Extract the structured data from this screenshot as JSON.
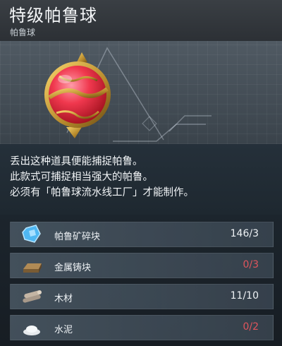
{
  "item": {
    "title": "特级帕鲁球",
    "category": "帕鲁球"
  },
  "description": [
    "丢出这种道具便能捕捉帕鲁。",
    "此款式可捕捉相当强大的帕鲁。",
    "必须有「帕鲁球流水线工厂」才能制作。"
  ],
  "materials": [
    {
      "icon": "ore-shard-icon",
      "name": "帕鲁矿碎块",
      "count": "146/3",
      "sufficient": true
    },
    {
      "icon": "ingot-icon",
      "name": "金属铸块",
      "count": "0/3",
      "sufficient": false
    },
    {
      "icon": "wood-icon",
      "name": "木材",
      "count": "11/10",
      "sufficient": true
    },
    {
      "icon": "cement-icon",
      "name": "水泥",
      "count": "0/2",
      "sufficient": false
    }
  ],
  "colors": {
    "insufficient": "#e0555c",
    "sufficient": "#eef2f5"
  }
}
